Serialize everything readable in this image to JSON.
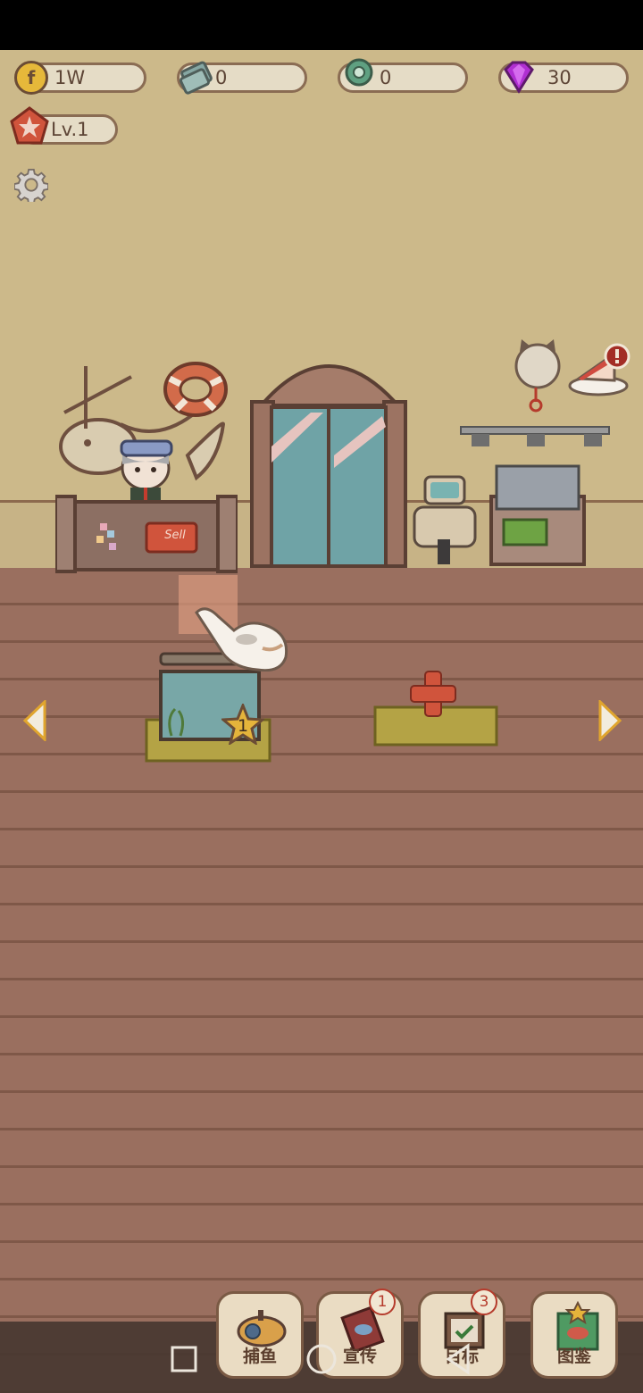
{
  "resources": {
    "coins": "1W",
    "fish_cans": "0",
    "pearls": "0",
    "gems": "30"
  },
  "player": {
    "level": "Lv.1"
  },
  "shop": {
    "sell_sign": "Sell"
  },
  "tanks": [
    {
      "slot": 1,
      "star_level": "1",
      "state": "tank"
    },
    {
      "slot": 2,
      "state": "empty-add"
    }
  ],
  "bottom_buttons": {
    "fishing": {
      "label": "捕鱼"
    },
    "promote": {
      "label": "宣传",
      "badge": "1"
    },
    "goals": {
      "label": "目标",
      "badge": "3"
    },
    "encyclopedia": {
      "label": "图鉴"
    }
  },
  "colors": {
    "wall": "#ccb98a",
    "floor": "#9a6f5f",
    "accent_red": "#d0543c",
    "gem_purple": "#b02fd2"
  },
  "icons": [
    "coin-icon",
    "fish-can-icon",
    "pearl-icon",
    "gem-icon",
    "level-star-icon",
    "gear-icon",
    "left-arrow-icon",
    "right-arrow-icon",
    "plus-icon",
    "pointing-hand-icon",
    "alert-icon"
  ]
}
